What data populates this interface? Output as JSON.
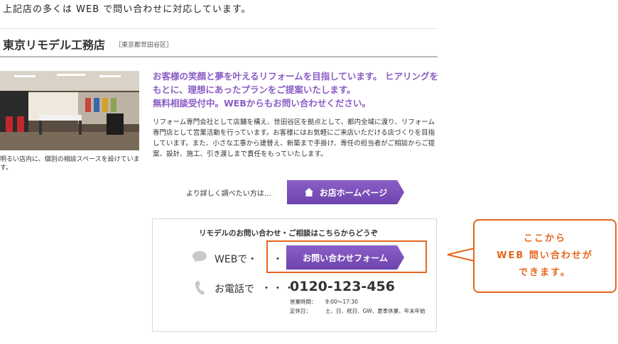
{
  "intro": "上記店の多くは WEB で問い合わせに対応しています。",
  "shop": {
    "name": "東京リモデル工務店",
    "area": "［東京都世田谷区］",
    "photo_caption": "明るい店内に、個別の相談スペースを設けています。",
    "catch_line1": "お客様の笑顔と夢を叶えるリフォームを目指しています。 ヒアリングをもとに、理想にあったプランをご提案いたします。",
    "catch_line2": "無料相談受付中。WEBからもお問い合わせください。",
    "description": "リフォーム専門会社として店舗を構え、世田谷区を拠点として、都内全域に渡り、リフォーム専門店として営業活動を行っています。お客様にはお気軽にご来店いただける店づくりを目指しています。また、小さな工事から建替え、新築まで手掛け、専任の担当者がご相談からご提案、設計、施工、引き渡しまで責任をもっていたします。",
    "more_text": "より詳しく調べたい方は…",
    "home_button": "お店ホームページ"
  },
  "contact": {
    "title": "リモデルのお問い合わせ・ご相談はこちらからどうぞ",
    "web_label": "WEBで・",
    "web_dot": "・",
    "form_button": "お問い合わせフォーム",
    "tel_label": "お電話で",
    "tel_dots": "・・・",
    "tel_number": "0120-123-456",
    "hours_label": "営業時間：",
    "hours_value": "9:00～17:30",
    "holiday_label": "定休日：",
    "holiday_value": "土、日、祝日、GW、夏季休業、年末年始"
  },
  "callout": {
    "line1": "ここから",
    "line2": "WEB 問い合わせが",
    "line3": "できます。"
  },
  "colors": {
    "accent_purple": "#8a5cc4",
    "button_purple": "#7a4fbb",
    "highlight_orange": "#e4661c"
  },
  "icons": [
    "home-icon",
    "chat-bubble-icon",
    "phone-icon"
  ]
}
